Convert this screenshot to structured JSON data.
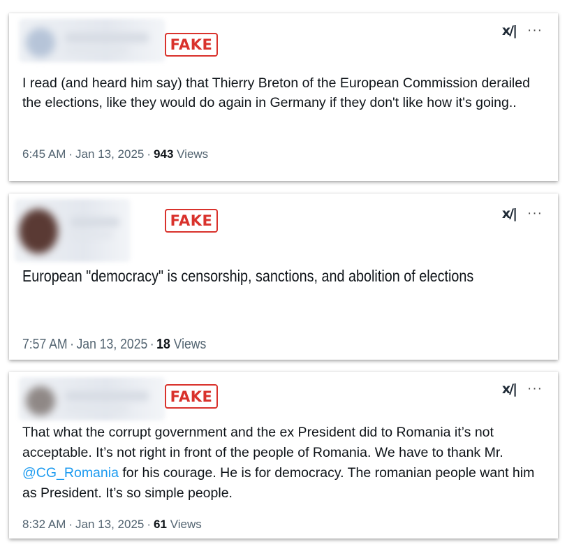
{
  "stamp_label": "FAKE",
  "colors": {
    "stamp": "#d9322c",
    "mention": "#1d9bf0",
    "meta": "#536471"
  },
  "icons": {
    "grok": "grok-icon",
    "more": "more-icon"
  },
  "grok_glyph": "x/|",
  "more_glyph": "···",
  "tweets": [
    {
      "text": "I read (and heard him say) that Thierry Breton of the European Commission derailed the elections, like they would do again in Germany if they don't like how it's going..",
      "time": "6:45 AM",
      "date": "Jan 13, 2025",
      "views_count": "943",
      "views_label": "Views"
    },
    {
      "text": "European \"democracy\" is censorship, sanctions, and abolition of elections",
      "time": "7:57 AM",
      "date": "Jan 13, 2025",
      "views_count": "18",
      "views_label": "Views"
    },
    {
      "text_before": "That what the corrupt government and the ex President did to Romania it’s not acceptable. It’s not right in front of the people of Romania. We have to thank Mr. ",
      "mention": "@CG_Romania",
      "text_after": " for his courage. He is for democracy. The romanian people want him as President. It’s so simple people.",
      "time": "8:32 AM",
      "date": "Jan 13, 2025",
      "views_count": "61",
      "views_label": "Views"
    }
  ]
}
